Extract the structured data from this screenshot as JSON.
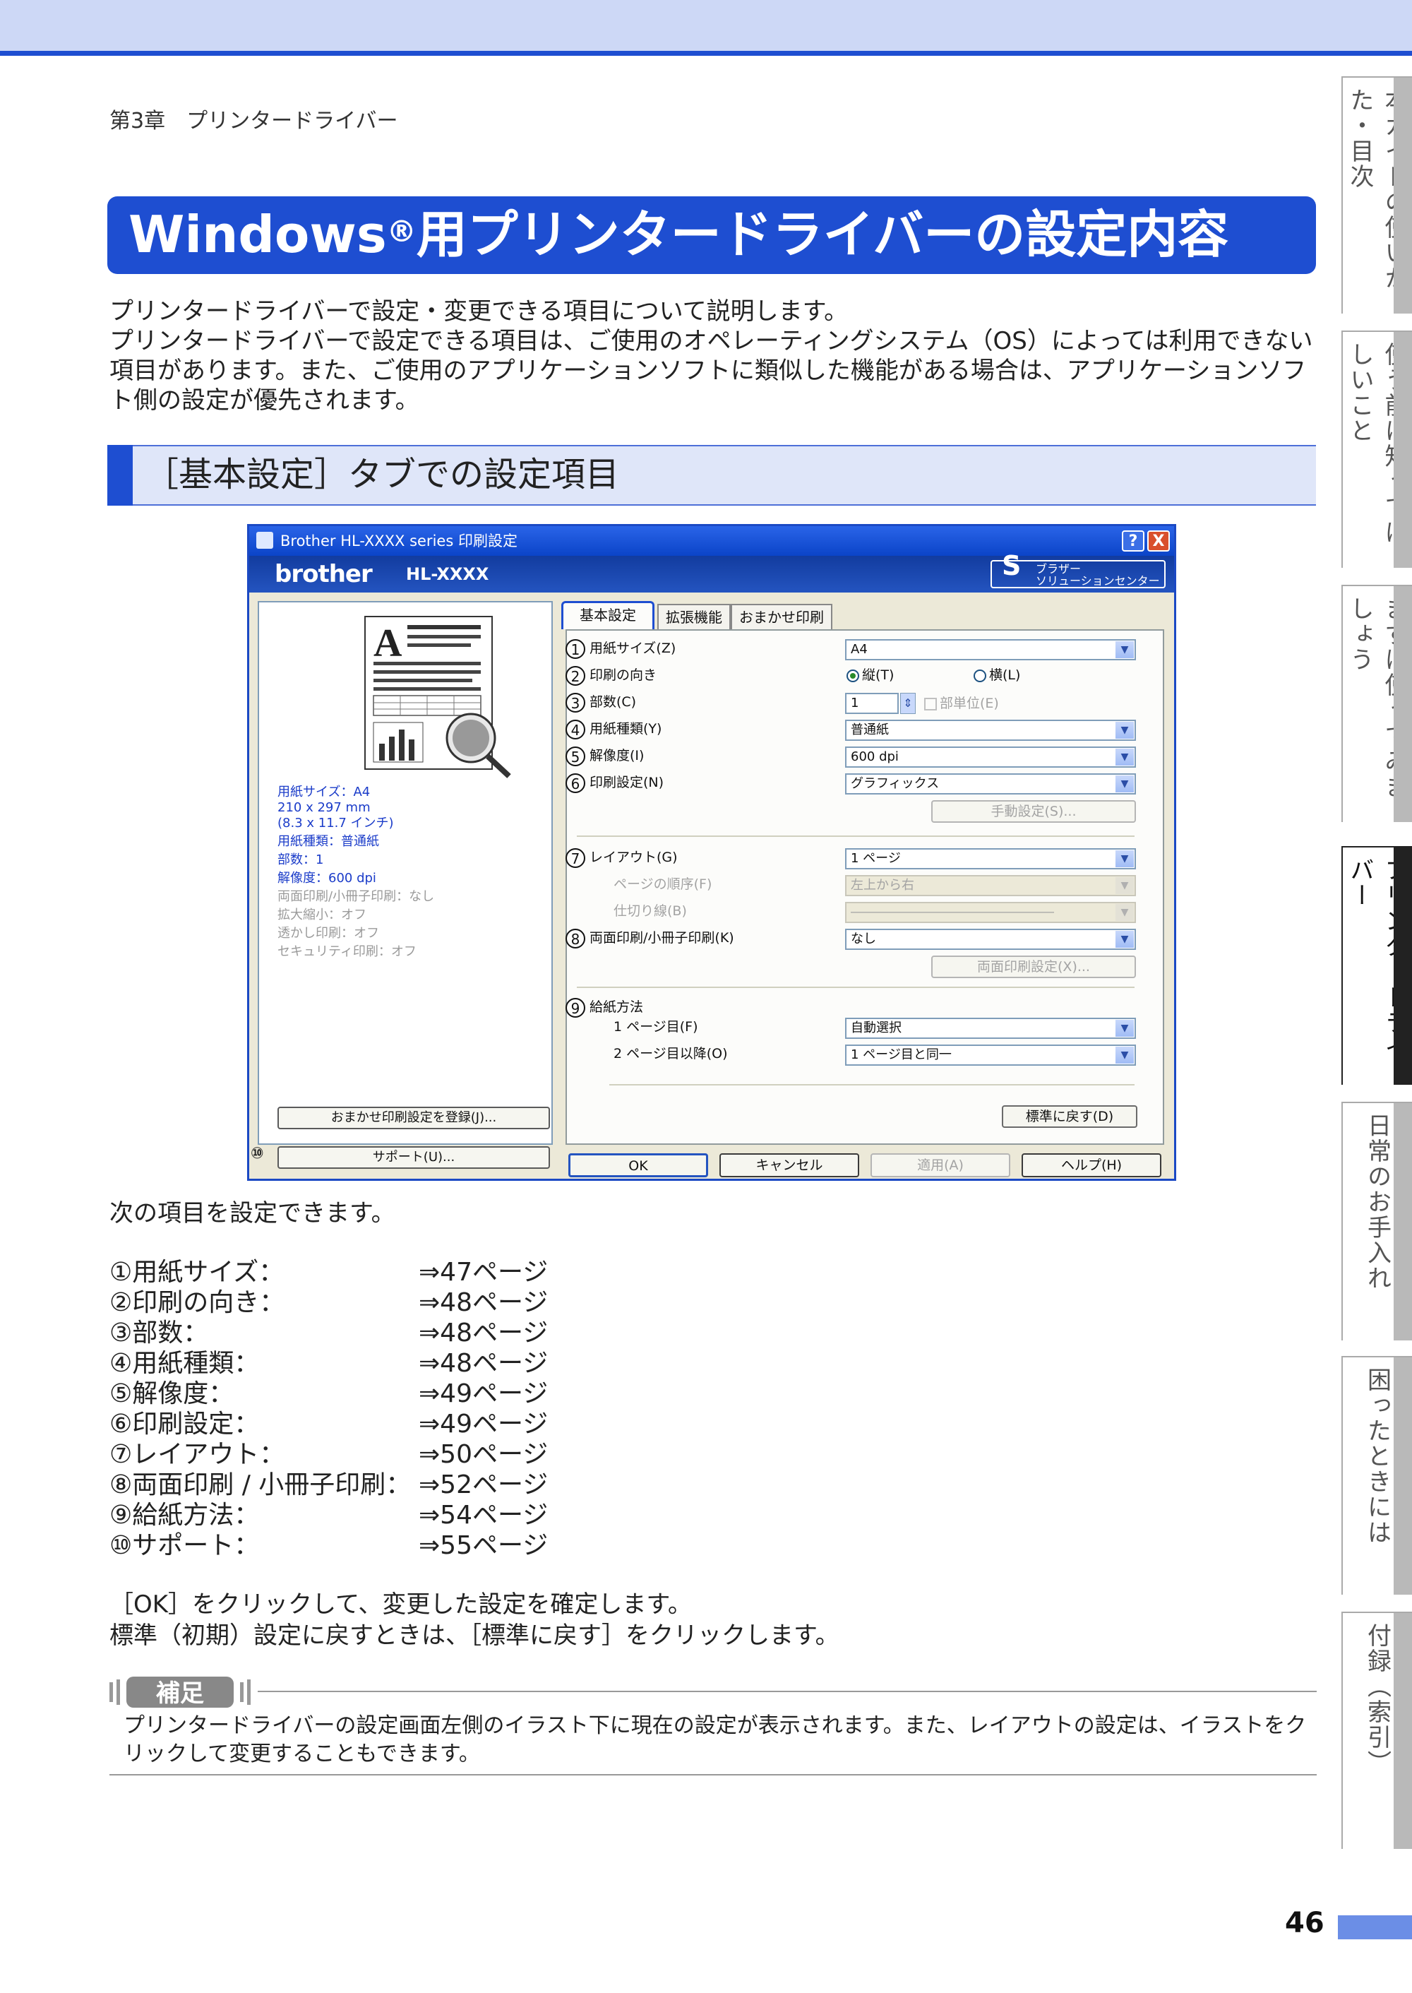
{
  "header": {
    "chapter": "第3章　プリンタードライバー"
  },
  "title": {
    "main": "Windows",
    "reg": "®",
    "rest": "用プリンタードライバーの設定内容"
  },
  "intro": {
    "line1": "プリンタードライバーで設定・変更できる項目について説明します。",
    "line2": "プリンタードライバーで設定できる項目は、ご使用のオペレーティングシステム（OS）によっては利用できない項目があります。また、ご使用のアプリケーションソフトに類似した機能がある場合は、アプリケーションソフト側の設定が優先されます。"
  },
  "section": {
    "title": "［基本設定］タブでの設定項目"
  },
  "side_tabs": [
    {
      "label": "本ガイドの使いかた・目次"
    },
    {
      "label": "使う前に知ってほしいこと"
    },
    {
      "label": "まずは使ってみましょう"
    },
    {
      "label": "プリンタードライバー"
    },
    {
      "label": "日常のお手入れ"
    },
    {
      "label": "困ったときには"
    },
    {
      "label": "付録（索引）"
    }
  ],
  "dialog": {
    "title": "Brother HL-XXXX series 印刷設定",
    "help_btn": "?",
    "close_btn": "X",
    "logo": "brother",
    "model": "HL-XXXX",
    "solution_s": "S",
    "solution_l1": "ブラザー",
    "solution_l2": "ソリューションセンター",
    "preview_letter": "A",
    "settings": {
      "paper_size": "用紙サイズ：A4",
      "dims_mm": "210 x 297 mm",
      "dims_in": "(8.3 x 11.7 インチ)",
      "media": "用紙種類：普通紙",
      "copies": "部数：1",
      "resolution": "解像度：600 dpi",
      "duplex": "両面印刷/小冊子印刷：なし",
      "scaling": "拡大縮小：オフ",
      "watermark": "透かし印刷：オフ",
      "secure": "セキュリティ印刷：オフ"
    },
    "register_btn": "おまかせ印刷設定を登録(J)...",
    "support_num": "⑩",
    "support_btn": "サポート(U)...",
    "tabs": [
      "基本設定",
      "拡張機能",
      "おまかせ印刷"
    ],
    "nums": [
      "1",
      "2",
      "3",
      "4",
      "5",
      "6",
      "7",
      "8",
      "9"
    ],
    "fields": {
      "paper_size_label": "用紙サイズ(Z)",
      "paper_size_value": "A4",
      "orientation_label": "印刷の向き",
      "portrait": "縦(T)",
      "landscape": "横(L)",
      "copies_label": "部数(C)",
      "copies_value": "1",
      "collate": "部単位(E)",
      "media_label": "用紙種類(Y)",
      "media_value": "普通紙",
      "resolution_label": "解像度(I)",
      "resolution_value": "600 dpi",
      "print_settings_label": "印刷設定(N)",
      "print_settings_value": "グラフィックス",
      "manual_btn": "手動設定(S)...",
      "layout_label": "レイアウト(G)",
      "layout_value": "1 ページ",
      "page_order_label": "ページの順序(F)",
      "page_order_value": "左上から右",
      "border_label": "仕切り線(B)",
      "border_value": "――――――――――――――――",
      "duplex_label": "両面印刷/小冊子印刷(K)",
      "duplex_value": "なし",
      "duplex_btn": "両面印刷設定(X)...",
      "source_label": "給紙方法",
      "first_page_label": "1 ページ目(F)",
      "first_page_value": "自動選択",
      "other_pages_label": "2 ページ目以降(O)",
      "other_pages_value": "1 ページ目と同一",
      "default_btn": "標準に戻す(D)"
    },
    "arrow": "▼",
    "spin": "⇕",
    "buttons": {
      "ok": "OK",
      "cancel": "キャンセル",
      "apply": "適用(A)",
      "help": "ヘルプ(H)"
    }
  },
  "after_text": "次の項目を設定できます。",
  "items": [
    {
      "label": "①用紙サイズ：",
      "page": "⇒47ページ"
    },
    {
      "label": "②印刷の向き：",
      "page": "⇒48ページ"
    },
    {
      "label": "③部数：",
      "page": "⇒48ページ"
    },
    {
      "label": "④用紙種類：",
      "page": "⇒48ページ"
    },
    {
      "label": "⑤解像度：",
      "page": "⇒49ページ"
    },
    {
      "label": "⑥印刷設定：",
      "page": "⇒49ページ"
    },
    {
      "label": "⑦レイアウト：",
      "page": "⇒50ページ"
    },
    {
      "label": "⑧両面印刷 / 小冊子印刷：",
      "page": "⇒52ページ"
    },
    {
      "label": "⑨給紙方法：",
      "page": "⇒54ページ"
    },
    {
      "label": "⑩サポート：",
      "page": "⇒55ページ"
    }
  ],
  "outro": {
    "line1": "［OK］をクリックして、変更した設定を確定します。",
    "line2": "標準（初期）設定に戻すときは、［標準に戻す］をクリックします。"
  },
  "note": {
    "badge": "補足",
    "text": "プリンタードライバーの設定画面左側のイラスト下に現在の設定が表示されます。また、レイアウトの設定は、イラストをクリックして変更することもできます。"
  },
  "page_number": "46",
  "colors": {
    "accent": "#1e4ed1",
    "light": "#cdd8f6",
    "section_bg": "#dfe6f9"
  }
}
